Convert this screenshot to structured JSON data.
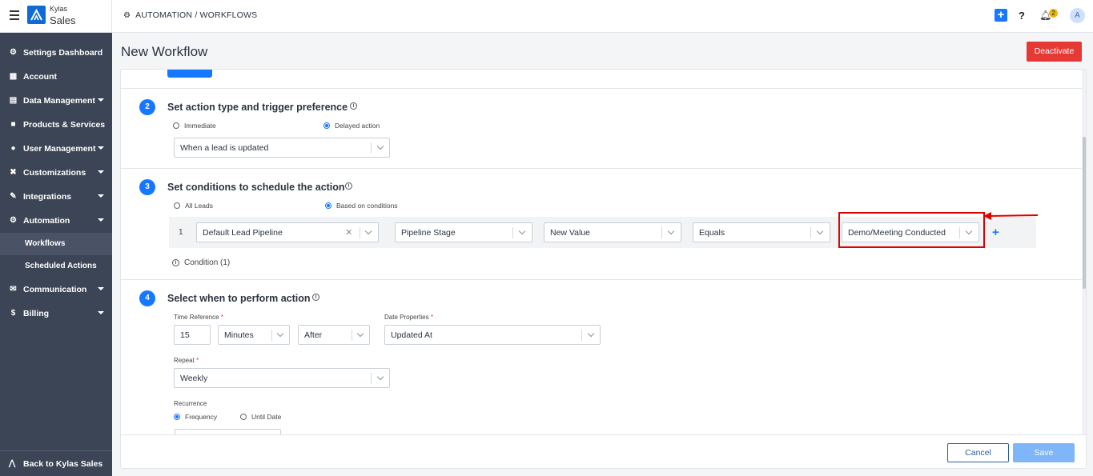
{
  "app": {
    "brand_top": "Kylas",
    "brand_main": "Sales"
  },
  "header": {
    "breadcrumb": "AUTOMATION / WORKFLOWS",
    "notif_count": "2",
    "avatar_initial": "A",
    "help_label": "?"
  },
  "sidebar": {
    "items": [
      {
        "label": "Settings Dashboard",
        "icon": "gear-icon"
      },
      {
        "label": "Account",
        "icon": "building-icon"
      },
      {
        "label": "Data Management",
        "icon": "table-icon"
      },
      {
        "label": "Products & Services",
        "icon": "box-icon"
      },
      {
        "label": "User Management",
        "icon": "users-icon"
      },
      {
        "label": "Customizations",
        "icon": "tools-icon"
      },
      {
        "label": "Integrations",
        "icon": "plug-icon"
      },
      {
        "label": "Automation",
        "icon": "gears-icon"
      },
      {
        "label": "Communication",
        "icon": "chat-icon"
      },
      {
        "label": "Billing",
        "icon": "dollar-icon"
      }
    ],
    "sub_items": [
      {
        "label": "Workflows",
        "active": true
      },
      {
        "label": "Scheduled Actions",
        "active": false
      }
    ],
    "back_label": "Back to Kylas Sales"
  },
  "page": {
    "title": "New Workflow",
    "deactivate_label": "Deactivate"
  },
  "step2": {
    "number": "2",
    "title": "Set action type and trigger preference",
    "options": [
      "Immediate",
      "Delayed action"
    ],
    "selected": "Delayed action",
    "trigger_value": "When a lead is updated"
  },
  "step3": {
    "number": "3",
    "title": "Set conditions to schedule the action",
    "options": [
      "All Leads",
      "Based on conditions"
    ],
    "selected": "Based on conditions",
    "row_index": "1",
    "pipeline": "Default Lead Pipeline",
    "field": "Pipeline Stage",
    "value_type": "New Value",
    "operator": "Equals",
    "value": "Demo/Meeting Conducted",
    "condition_count_label": "Condition (1)"
  },
  "step4": {
    "number": "4",
    "title": "Select when to perform action",
    "time_reference_label": "Time Reference",
    "time_value": "15",
    "time_unit": "Minutes",
    "time_direction": "After",
    "date_properties_label": "Date Properties",
    "date_property": "Updated At",
    "repeat_label": "Repeat",
    "repeat_value": "Weekly",
    "recurrence_label": "Recurrence",
    "recurrence_options": [
      "Frequency",
      "Until Date"
    ],
    "recurrence_selected": "Frequency"
  },
  "footer": {
    "cancel_label": "Cancel",
    "save_label": "Save"
  },
  "colors": {
    "accent": "#1677ff",
    "sidebar": "#3c4555",
    "danger": "#e53935",
    "highlight": "#e00000"
  }
}
